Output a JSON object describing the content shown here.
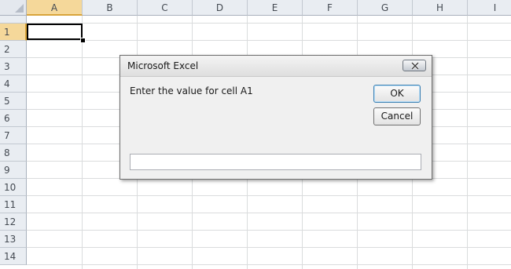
{
  "spreadsheet": {
    "columns": [
      "A",
      "B",
      "C",
      "D",
      "E",
      "F",
      "G",
      "H",
      "I"
    ],
    "rows": [
      "1",
      "2",
      "3",
      "4",
      "5",
      "6",
      "7",
      "8",
      "9",
      "10",
      "11",
      "12",
      "13",
      "14"
    ],
    "active_cell": "A1"
  },
  "dialog": {
    "title": "Microsoft Excel",
    "prompt": "Enter the value for cell A1",
    "ok_label": "OK",
    "cancel_label": "Cancel",
    "input_value": "",
    "close_icon": "close-icon"
  },
  "colors": {
    "header_bg": "#e9edf2",
    "active_header_bg": "#f5d89a",
    "gridline": "#dadcdd",
    "dialog_bg": "#f0f0f0"
  }
}
